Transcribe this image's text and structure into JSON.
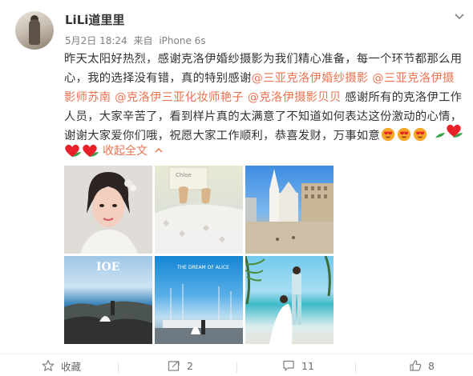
{
  "post": {
    "user_name": "LiLi道里里",
    "date": "5月2日 18:24",
    "source_prefix": "来自",
    "source": "iPhone 6s",
    "text_intro": "昨天太阳好热烈，感谢克洛伊婚纱摄影为我们精心准备，每一个环节都那么用心，我的选择没有错，真的特别感谢",
    "mention_1": "@三亚克洛伊婚纱摄影",
    "mention_2": "@三亚克洛伊摄影师苏南",
    "mention_3": "@克洛伊三亚化妆师艳子",
    "mention_4": "@克洛伊摄影贝贝",
    "text_outro": " 感谢所有的克洛伊工作人员，大家辛苦了，看到样片真的太满意了不知道如何表达这份激动的心情，谢谢大家爱你们哦，祝愿大家工作顺利，恭喜发财，万事如意",
    "collapse_label": "收起全文",
    "photo_4_title": "IOE",
    "photo_5_title": "THE DREAM OF ALICE",
    "photo_2_label": "Chloe"
  },
  "actions": {
    "favorite_label": "收藏",
    "repost_count": "2",
    "comment_count": "11",
    "like_count": "8"
  },
  "colors": {
    "mention": "#eb7350",
    "text": "#333333",
    "meta": "#808080"
  },
  "icons": [
    "more-icon",
    "heart-eyes-emoji",
    "leaf-emoji",
    "heart-emoji",
    "chevron-up-icon",
    "star-icon",
    "repost-icon",
    "comment-icon",
    "like-icon"
  ]
}
